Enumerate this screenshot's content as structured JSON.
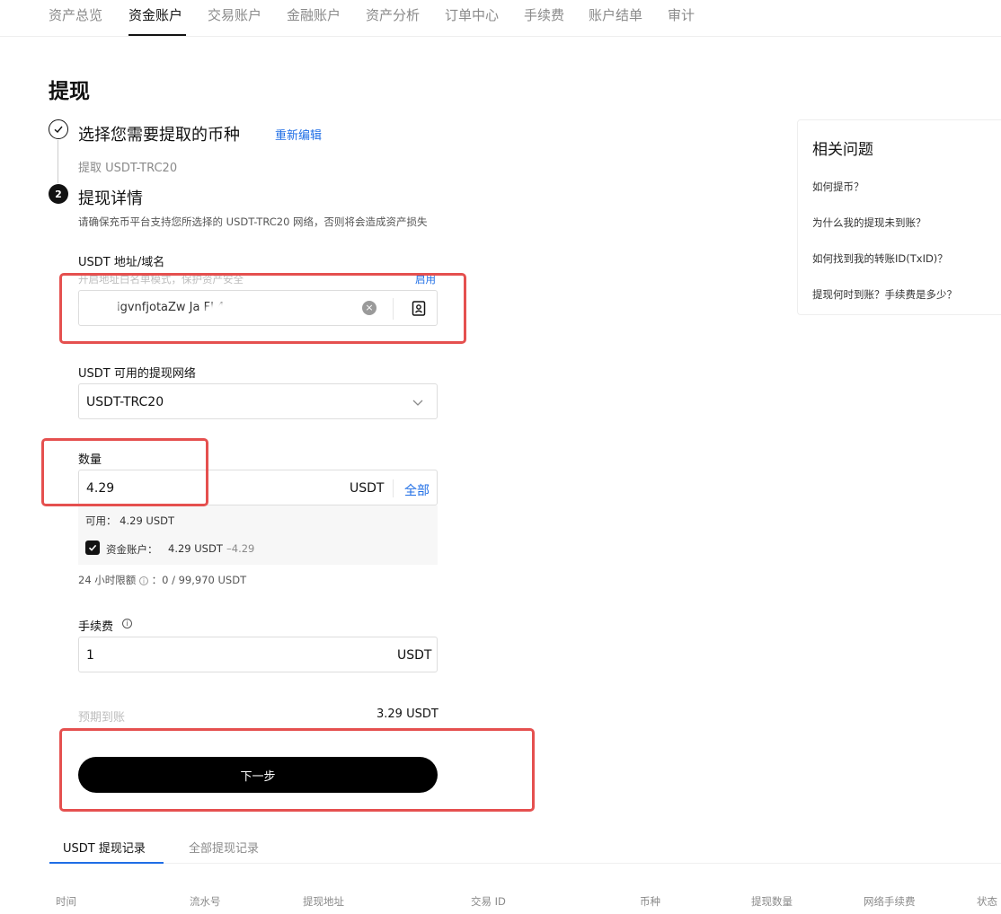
{
  "nav": {
    "items": [
      "资产总览",
      "资金账户",
      "交易账户",
      "金融账户",
      "资产分析",
      "订单中心",
      "手续费",
      "账户结单",
      "审计"
    ],
    "active_index": 1
  },
  "page_title": "提现",
  "steps": {
    "step1": {
      "title": "选择您需要提取的币种",
      "edit_link": "重新编辑",
      "selected": "提取 USDT-TRC20"
    },
    "step2": {
      "number": "2",
      "title": "提现详情",
      "notice": "请确保充币平台支持您所选择的 USDT-TRC20 网络，否则将会造成资产损失"
    }
  },
  "address": {
    "label": "USDT 地址/域名",
    "hint": "开启地址白名单模式，保护资产安全",
    "enable_link": "启用",
    "value": "igvnfjotaZw    Ja        FL4"
  },
  "network": {
    "label": "USDT 可用的提现网络",
    "value": "USDT-TRC20"
  },
  "amount": {
    "label": "数量",
    "value": "4.29",
    "unit": "USDT",
    "all_button": "全部",
    "available": "可用：  4.29 USDT",
    "account_label": "资金账户：",
    "account_amount": "4.29 USDT",
    "account_delta": "–4.29",
    "checked": true
  },
  "limit": {
    "prefix": "24 小时限额",
    "suffix": "：0 / 99,970 USDT"
  },
  "fee": {
    "label": "手续费",
    "value": "1",
    "unit": "USDT"
  },
  "expected": {
    "label": "预期到账",
    "value": "3.29 USDT"
  },
  "next_button": "下一步",
  "tabs": [
    "USDT 提现记录",
    "全部提现记录"
  ],
  "table_headers": [
    "时间",
    "流水号",
    "提现地址",
    "交易 ID",
    "币种",
    "提现数量",
    "网络手续费",
    "状态"
  ],
  "faq": {
    "title": "相关问题",
    "items": [
      "如何提币？",
      "为什么我的提现未到账？",
      "如何找到我的转账ID(TxID)？",
      "提现何时到账？手续费是多少？"
    ]
  },
  "colors": {
    "accent": "#1f6ee6",
    "primary_button": "#000000",
    "annotation_red": "#e5504f"
  }
}
